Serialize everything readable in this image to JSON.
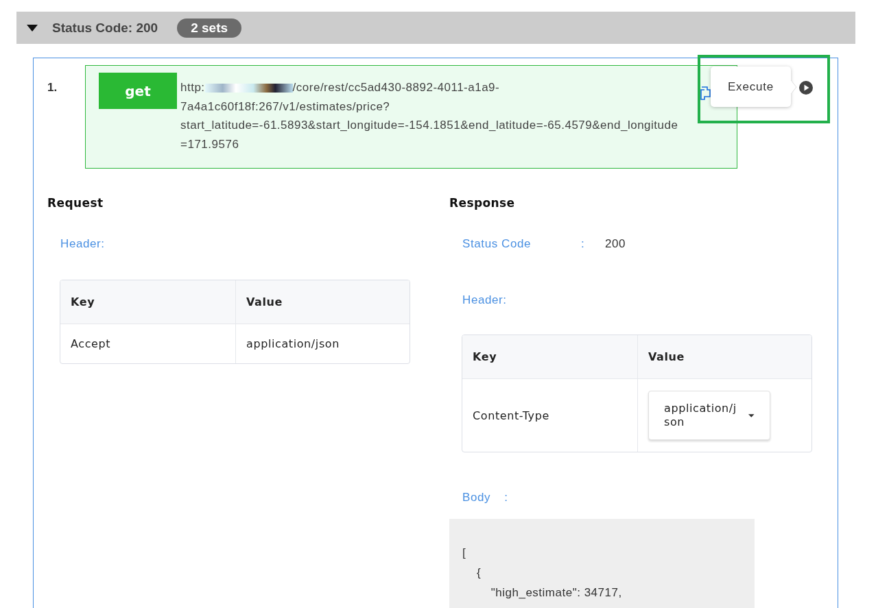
{
  "group": {
    "title": "Status Code: 200",
    "count": "2 sets",
    "expanded": true
  },
  "entries": [
    {
      "index": "1.",
      "method": "get",
      "url_start": "http:",
      "url_rest": "/core/rest/cc5ad430-8892-4011-a1a9-7a4a1c60f18f:267/v1/estimates/price?start_latitude=-61.5893&start_longitude=-154.1851&end_latitude=-65.4579&end_longitude=171.9576",
      "tooltip": "Execute",
      "highlighted": true,
      "request": {
        "title": "Request",
        "header_label": "Header:",
        "columns": [
          "Key",
          "Value"
        ],
        "rows": [
          {
            "key": "Accept",
            "value": "application/json",
            "kind": "text"
          }
        ]
      },
      "response": {
        "title": "Response",
        "status_label": "Status Code",
        "status_separator": ":",
        "status_value": "200",
        "header_label": "Header:",
        "columns": [
          "Key",
          "Value"
        ],
        "rows": [
          {
            "key": "Content-Type",
            "value": "application/json",
            "kind": "dropdown"
          }
        ],
        "body_label": "Body",
        "body_separator": ":",
        "body_lines": [
          "[",
          "    {",
          "        \"high_estimate\": 34717,"
        ]
      }
    }
  ]
}
